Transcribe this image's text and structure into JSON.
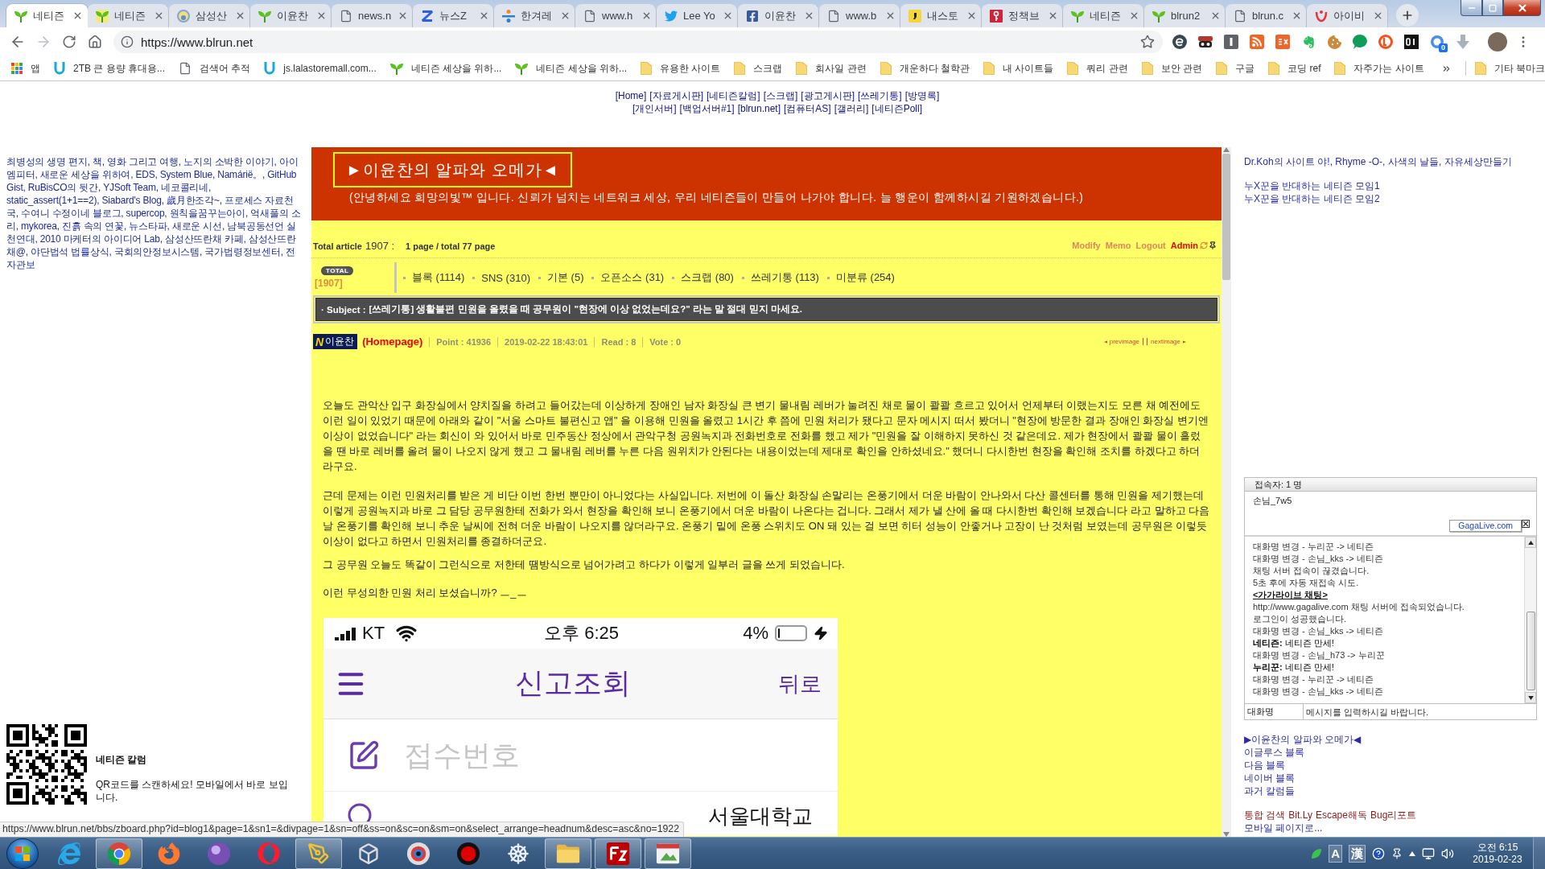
{
  "browser": {
    "tabs": [
      {
        "title": "네티즌",
        "selected": true
      },
      {
        "title": "네티즌",
        "selected": false
      },
      {
        "title": "삼성산",
        "selected": false
      },
      {
        "title": "이윤찬",
        "selected": false
      },
      {
        "title": "news.n",
        "selected": false
      },
      {
        "title": "뉴스Z",
        "selected": false
      },
      {
        "title": "한겨레",
        "selected": false
      },
      {
        "title": "www.h",
        "selected": false
      },
      {
        "title": "Lee Yo",
        "selected": false
      },
      {
        "title": "이윤찬",
        "selected": false
      },
      {
        "title": "www.b",
        "selected": false
      },
      {
        "title": "내스토",
        "selected": false
      },
      {
        "title": "정책브",
        "selected": false
      },
      {
        "title": "네티즌",
        "selected": false
      },
      {
        "title": "blrun2",
        "selected": false
      },
      {
        "title": "blrun.c",
        "selected": false
      },
      {
        "title": "아이비",
        "selected": false
      }
    ],
    "url": "https://www.blrun.net",
    "extension_badge": "0",
    "bookmarks": [
      {
        "label": "앱",
        "kind": "apps"
      },
      {
        "label": "2TB 큰 용량 휴대용...",
        "kind": "site"
      },
      {
        "label": "검색어 추적",
        "kind": "site"
      },
      {
        "label": "js.lalastoremall.com...",
        "kind": "site"
      },
      {
        "label": "네티즌 세상을 위하...",
        "kind": "site"
      },
      {
        "label": "네티즌 세상을 위하...",
        "kind": "site"
      },
      {
        "label": "유용한 사이트",
        "kind": "folder"
      },
      {
        "label": "스크랩",
        "kind": "folder"
      },
      {
        "label": "회사일 관련",
        "kind": "folder"
      },
      {
        "label": "개운하다 철학관",
        "kind": "folder"
      },
      {
        "label": "내 사이트들",
        "kind": "folder"
      },
      {
        "label": "쿼리 관련",
        "kind": "folder"
      },
      {
        "label": "보안 관련",
        "kind": "folder"
      },
      {
        "label": "구글",
        "kind": "folder"
      },
      {
        "label": "코딩 ref",
        "kind": "folder"
      },
      {
        "label": "자주가는 사이트",
        "kind": "folder"
      }
    ],
    "more_bookmarks": "기타 북마크"
  },
  "top_nav": [
    [
      "[Home]",
      "[자료게시판]",
      "[네티즌칼럼]",
      "[스크랩]",
      "[광고게시판]",
      "[쓰레기통]",
      "[방명록]"
    ],
    [
      "[개인서버]",
      "[백업서버#1]",
      "[blrun.net]",
      "[컴퓨터AS]",
      "[갤러리]",
      "[네티즌Poll]"
    ]
  ],
  "left_column": {
    "blogroll": "최병성의 생명 편지, 책, 영화 그리고 여행, 노지의 소박한 이야기, 아이엠피터, 새로운 세상을 위하여, EDS, System Blue, Namárië。, GitHub Gist, RuBisCO의 뒷간, YJSoft Team, 네코콜리네, static_assert(1+1==2), Siabard's Blog, 歲月한조각~, 프로세스 자료천국, 수여니 수정이네 블로그, supercop, 원칙을꿈꾸는아이, 억새풀의 소리, mykorea, 진흙 속의 연꽃, 뉴스타파, 새로운 시선, 남북공동선언 실천연대, 2010 마케터의 아이디어 Lab, 삼성산뜨란채 카페, 삼성산뜨란채@, 야단법석 법률상식, 국회의안정보시스템, 국가법령정보센터, 전자관보",
    "qr_title": "네티즌 칼럼",
    "qr_caption": "QR코드를 스캔하세요! 모바일에서 바로 보입니다."
  },
  "board": {
    "title": "►이윤찬의 알파와 오메가◄",
    "greeting": "(안녕하세요 희망의빛™ 입니다. 신뢰가 넘치는 네트워크 세상, 우리 네티즌들이 만들어 나가야 합니다. 늘 행운이 함께하시길 기원하겠습니다.)",
    "stats": {
      "label": "Total article",
      "count": "1907 :",
      "pages": "1 page / total 77 page"
    },
    "admin_links": [
      {
        "label": "Modify",
        "kind": "link"
      },
      {
        "label": "Memo",
        "kind": "link"
      },
      {
        "label": "Logout",
        "kind": "link"
      },
      {
        "label": "Admin",
        "kind": "admin"
      }
    ],
    "total_badge": "TOTAL",
    "total_count": "[1907]",
    "categories": [
      "블록 (1114)",
      "SNS (310)",
      "기본 (5)",
      "오픈소스 (31)",
      "스크랩 (80)",
      "쓰레기통 (113)",
      "미분류 (254)"
    ],
    "subject_label": "· Subject :",
    "subject": "[쓰레기통] 생활불편 민원을 올렸을 때 공무원이 \"현장에 이상 없었는데요?\" 라는 말 절대 믿지 마세요.",
    "author": {
      "mark": "N",
      "name": "이윤찬",
      "homepage": "(Homepage)"
    },
    "meta": [
      "Point : 41936",
      "2019-02-22 18:43:01",
      "Read : 8",
      "Vote : 0"
    ],
    "image_nav": [
      "previmage",
      "nextimage"
    ],
    "paragraphs": [
      "오늘도 관악산 입구 화장실에서 양치질을 하려고 들어갔는데 이상하게 장애인 남자 화장실 큰 변기 물내림 레버가 눌려진 채로 물이 콸콸 흐르고 있어서 언제부터 이랬는지도 모른 채 예전에도 이런 일이 있었기 때문에 아래와 같이 \"서울 스마트 불편신고 앱\" 을 이용해 민원을 올렸고 1시간 후 쯤에 민원 처리가 됐다고 문자 메시지 떠서 봤더니 \"현장에 방문한 결과 장애인 화장실 변기엔 이상이 없었습니다\" 라는 회신이 와 있어서 바로 민주동산 정상에서 관악구청 공원녹지과 전화번호로 전화를 했고 제가 \"민원을 잘 이해하지 못하신 것 같은데요. 제가 현장에서 콸콸 물이 흘렀을 땐 바로 레버를 올려 물이 나오지 않게 했고 그 물내림 레버를 누른 다음 원위치가 안된다는 내용이었는데 제대로 확인을 안하셨네요.\" 했더니 다시한번 현장을 확인해 조치를 하겠다고 하더라구요.",
      "근데 문제는 이런 민원처리를 받은 게 비단 이번 한번 뿐만이 아니었다는 사실입니다. 저번에 이 돌산 화장실 손말리는 온풍기에서 더운 바람이 안나와서 다산 콜센터를 통해 민원을 제기했는데 이렇게 공원녹지과 바로 그 담당 공무원한테 전화가 와서 현장을 확인해 보니 온풍기에서 더운 바람이 나온다는 겁니다. 그래서 제가 낼 산에 올 때 다시한번 확인해 보겠습니다 라고 말하고 다음날 온풍기를 확인해 보니 추운 날씨에 전혀 더운 바람이 나오지를 않더라구요. 온풍기 밑에 온풍 스위치도 ON 돼 있는 걸 보면 히터 성능이 안좋거나 고장이 난 것처럼 보였는데 공무원은 이렇듯 이상이 없다고 하면서 민원처리를 종결하더군요.",
      "그 공무원 오늘도 똑같이 그런식으로 저한테 땜방식으로 넘어가려고 하다가 이렇게 일부러 글을 쓰게 되었습니다.",
      "이런 무성의한 민원 처리 보셨습니까? ㅡ_ㅡ"
    ],
    "phone": {
      "carrier": "KT",
      "time": "오후 6:25",
      "battery": {
        "reading": "4%",
        "level": 0.04
      },
      "title": "신고조회",
      "back": "뒤로",
      "receipt_field": {
        "placeholder": "접수번호"
      },
      "office": "서울대학교"
    }
  },
  "right_column": {
    "sites": "Dr.Koh의 사이트 야!, Rhyme -O-, 사색의 날들, 자유세상만들기",
    "groups": [
      "누X꾼을 반대하는 네티즌 모임1",
      "누X꾼을 반대하는 네티즌 모임2"
    ],
    "chat": {
      "users_label": "접속자: 1 명",
      "users": [
        "손님_7w5"
      ],
      "brand": "GagaLive.com",
      "log": [
        {
          "kind": "system",
          "text": "대화명 변경 - 누리꾼 -> 네티즌"
        },
        {
          "kind": "system",
          "text": "대화명 변경 - 손님_kks -> 네티즌"
        },
        {
          "kind": "system",
          "text": "채팅 서버 접속이 끊겼습니다."
        },
        {
          "kind": "system",
          "text": "5초 후에 자동 재접속 시도."
        },
        {
          "kind": "heading",
          "text": "<가가라이브 채팅>"
        },
        {
          "kind": "system",
          "text": "http://www.gagalive.com 채팅 서버에 접속되었습니다."
        },
        {
          "kind": "system",
          "text": "로그인이 성공했습니다."
        },
        {
          "kind": "system",
          "text": "대화명 변경 - 손님_kks -> 네티즌"
        },
        {
          "kind": "chat",
          "text": "**네티즌:** 네티즌 만세!"
        },
        {
          "kind": "system",
          "text": "대화명 변경 - 손님_h73 -> 누리꾼"
        },
        {
          "kind": "chat",
          "text": "**누리꾼:** 네티즌 만세!"
        },
        {
          "kind": "system",
          "text": "대화명 변경 - 누리꾼 -> 네티즌"
        },
        {
          "kind": "system",
          "text": "대화명 변경 - 손님_kks -> 네티즌"
        }
      ],
      "nick_field": {
        "value": "대화명"
      },
      "message_field": {
        "placeholder": "메시지를 입력하시길 바랍니다."
      }
    },
    "links": [
      "▶이윤찬의 알파와 오메가◀",
      "이글루스 블록",
      "다음 블록",
      "네이버 블록",
      "과거 칼럼들"
    ],
    "tools": [
      "통합 검색",
      "Bit.Ly",
      "Escape해독",
      "Bug리포트"
    ],
    "mobile": "모바일 페이지로..."
  },
  "status_url": "https://www.blrun.net/bbs/zboard.php?id=blog1&page=1&sn1=&divpage=1&sn=off&ss=on&sc=on&sm=on&select_arrange=headnum&desc=asc&no=1922",
  "taskbar": {
    "apps": [
      {
        "running": false
      },
      {
        "running": true
      },
      {
        "running": false
      },
      {
        "running": false
      },
      {
        "running": false
      },
      {
        "running": true
      },
      {
        "running": false
      },
      {
        "running": false
      },
      {
        "running": false
      },
      {
        "running": false
      },
      {
        "running": true
      },
      {
        "running": true
      },
      {
        "running": true
      }
    ],
    "ime": [
      "A",
      "漢"
    ],
    "time": "오전 6:15",
    "date": "2019-02-23"
  }
}
